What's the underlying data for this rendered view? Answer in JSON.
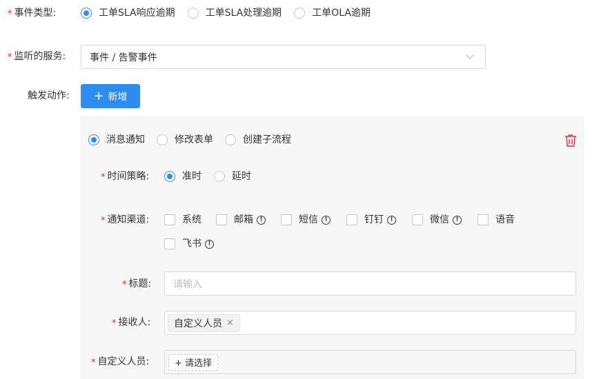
{
  "event_type": {
    "label": "事件类型:",
    "options": [
      "工单SLA响应逾期",
      "工单SLA处理逾期",
      "工单OLA逾期"
    ],
    "selected_index": 0
  },
  "service": {
    "label": "监听的服务:",
    "value": "事件 / 告警事件"
  },
  "trigger": {
    "label": "触发动作:",
    "add_label": "新增"
  },
  "action": {
    "types": [
      "消息通知",
      "修改表单",
      "创建子流程"
    ],
    "selected_index": 0,
    "time_policy": {
      "label": "时间策略:",
      "options": [
        "准时",
        "延时"
      ],
      "selected_index": 0
    },
    "channels": {
      "label": "通知渠道:",
      "items": [
        {
          "label": "系统",
          "info": false
        },
        {
          "label": "邮箱",
          "info": true
        },
        {
          "label": "短信",
          "info": true
        },
        {
          "label": "钉钉",
          "info": true
        },
        {
          "label": "微信",
          "info": true
        },
        {
          "label": "语音",
          "info": false
        },
        {
          "label": "飞书",
          "info": true
        }
      ]
    },
    "title": {
      "label": "标题:",
      "placeholder": "请输入"
    },
    "recipient": {
      "label": "接收人:",
      "tag": "自定义人员",
      "tag_remove": "×"
    },
    "custom_people": {
      "label": "自定义人员:",
      "button": "+ 请选择"
    }
  },
  "colors": {
    "primary": "#2e8cf0",
    "required": "#f5222d",
    "delete": "#f5222d"
  }
}
